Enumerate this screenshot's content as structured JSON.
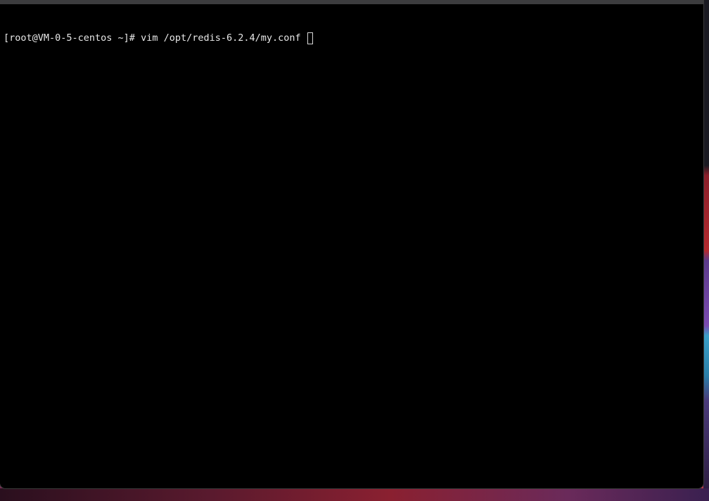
{
  "terminal": {
    "prompt": "[root@VM-0-5-centos ~]# ",
    "command": "vim /opt/redis-6.2.4/my.conf ",
    "cursor_style": "hollow-block"
  },
  "colors": {
    "terminal_background": "#000000",
    "terminal_text": "#e8e8e8",
    "window_edge": "#3c3c3e"
  }
}
